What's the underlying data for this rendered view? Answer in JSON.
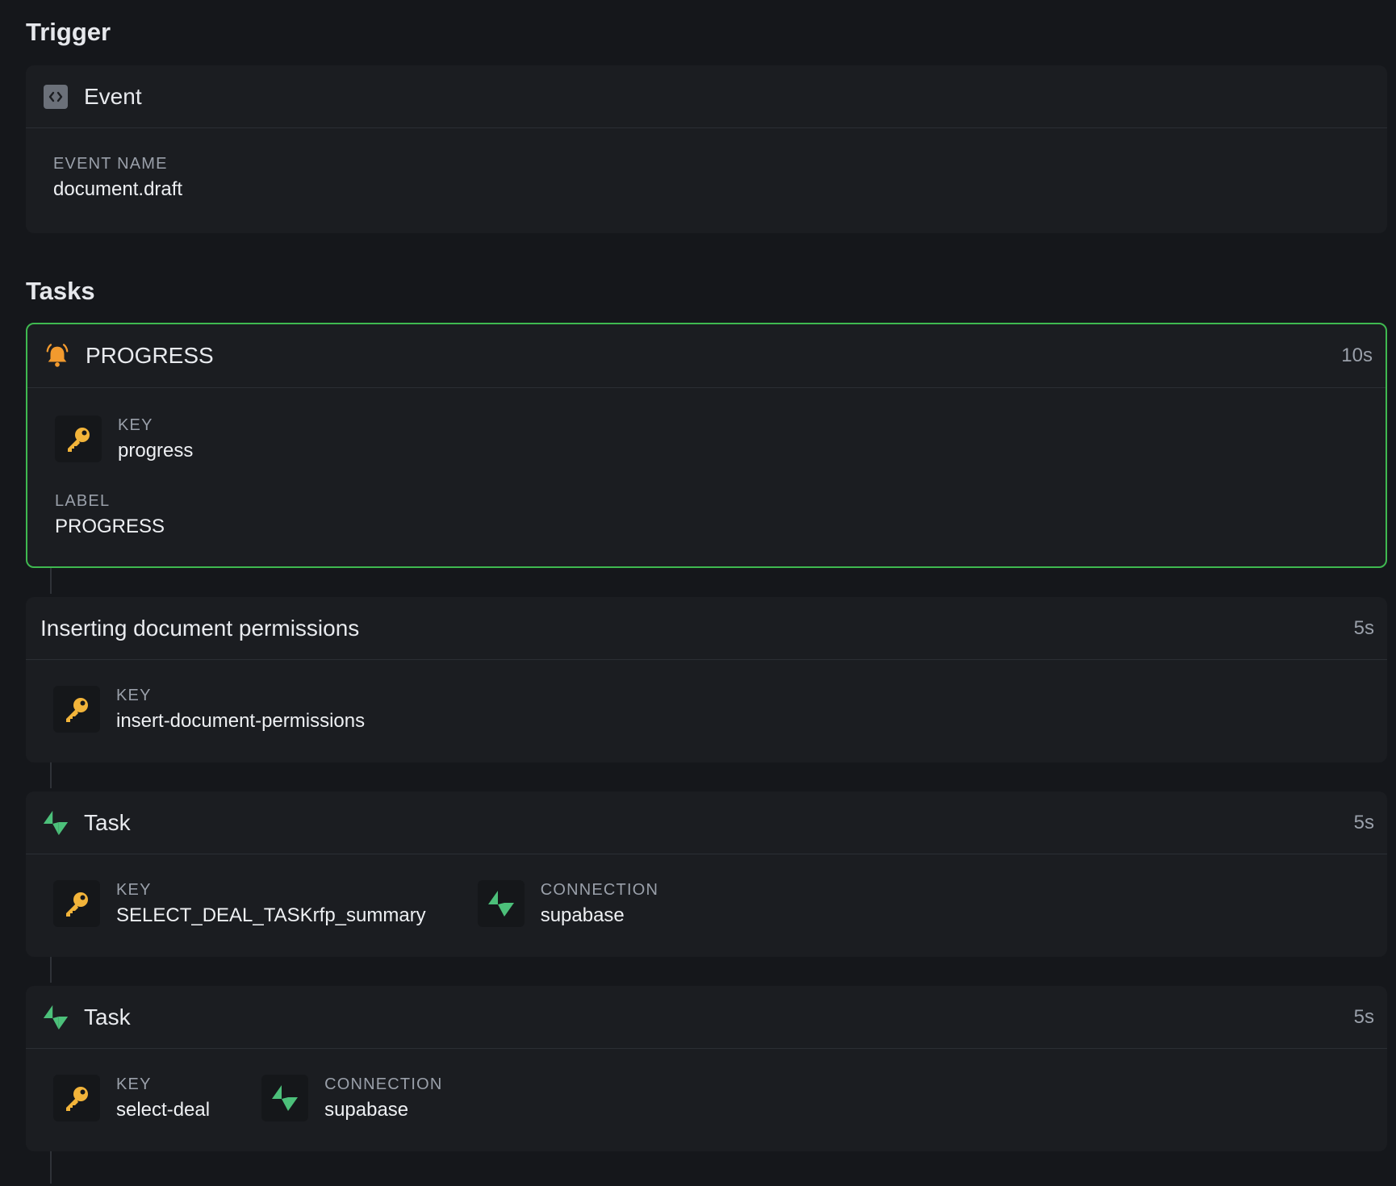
{
  "trigger": {
    "heading": "Trigger",
    "title": "Event",
    "event_name_label": "EVENT NAME",
    "event_name": "document.draft"
  },
  "tasks": {
    "heading": "Tasks",
    "items": [
      {
        "title": "PROGRESS",
        "duration": "10s",
        "key_label": "KEY",
        "key": "progress",
        "label_label": "LABEL",
        "label": "PROGRESS"
      },
      {
        "title": "Inserting document permissions",
        "duration": "5s",
        "key_label": "KEY",
        "key": "insert-document-permissions"
      },
      {
        "title": "Task",
        "duration": "5s",
        "key_label": "KEY",
        "key": "SELECT_DEAL_TASKrfp_summary",
        "connection_label": "CONNECTION",
        "connection": "supabase"
      },
      {
        "title": "Task",
        "duration": "5s",
        "key_label": "KEY",
        "key": "select-deal",
        "connection_label": "CONNECTION",
        "connection": "supabase"
      }
    ]
  },
  "colors": {
    "background": "#15171b",
    "card": "#1b1d21",
    "active_border": "#3fb950",
    "key_icon": "#f2b43a",
    "bolt_icon": "#4cc07a",
    "bell_icon": "#f29a2e"
  },
  "icons": [
    "code-icon",
    "bell-icon",
    "key-icon",
    "bolt-icon"
  ]
}
